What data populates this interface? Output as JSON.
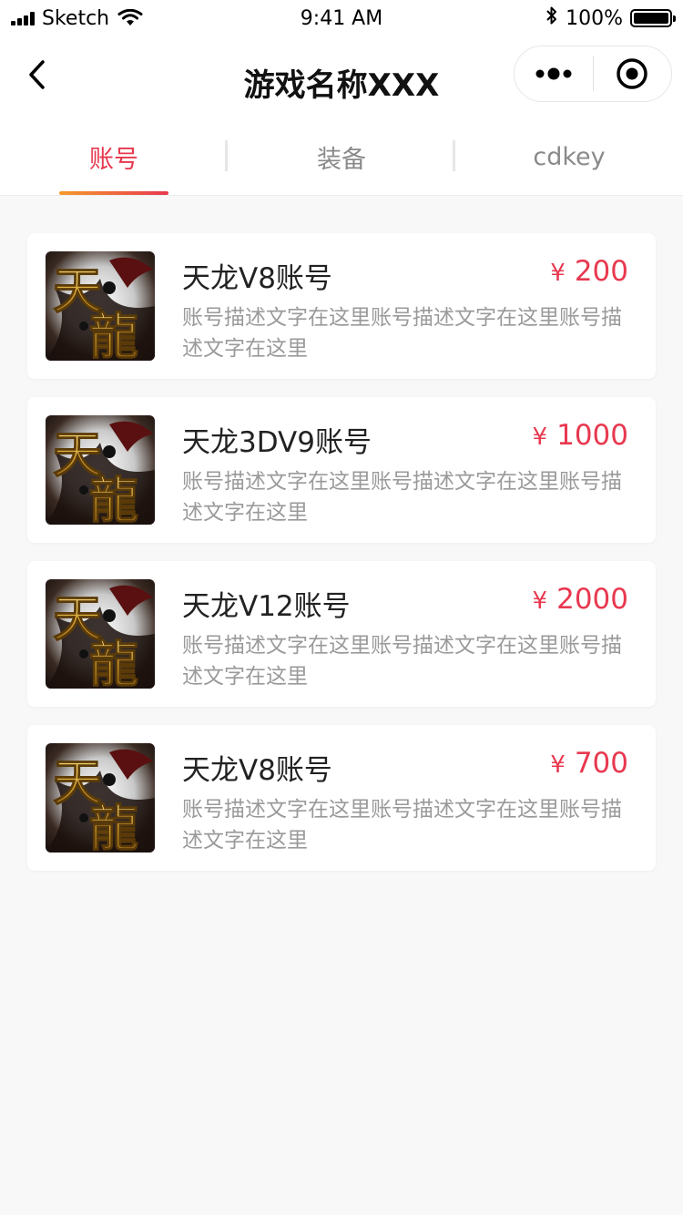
{
  "status_bar": {
    "carrier": "Sketch",
    "time": "9:41 AM",
    "battery": "100%",
    "battery_level": 1.0
  },
  "nav": {
    "title": "游戏名称XXX",
    "icons": {
      "back": "back-chevron-icon",
      "more": "more-dots-icon",
      "close": "target-close-icon"
    }
  },
  "tabs": [
    {
      "label": "账号",
      "active": true
    },
    {
      "label": "装备",
      "active": false
    },
    {
      "label": "cdkey",
      "active": false
    }
  ],
  "colors": {
    "accent": "#e8384f",
    "accent_gradient_start": "#f59a2b",
    "background": "#f8f8f8",
    "card": "#ffffff"
  },
  "items": [
    {
      "title": "天龙V8账号",
      "currency": "¥",
      "price": "200",
      "description": "账号描述文字在这里账号描述文字在这里账号描述文字在这里"
    },
    {
      "title": "天龙3DV9账号",
      "currency": "¥",
      "price": "1000",
      "description": "账号描述文字在这里账号描述文字在这里账号描述文字在这里"
    },
    {
      "title": "天龙V12账号",
      "currency": "¥",
      "price": "2000",
      "description": "账号描述文字在这里账号描述文字在这里账号描述文字在这里"
    },
    {
      "title": "天龙V8账号",
      "currency": "¥",
      "price": "700",
      "description": "账号描述文字在这里账号描述文字在这里账号描述文字在这里"
    }
  ]
}
